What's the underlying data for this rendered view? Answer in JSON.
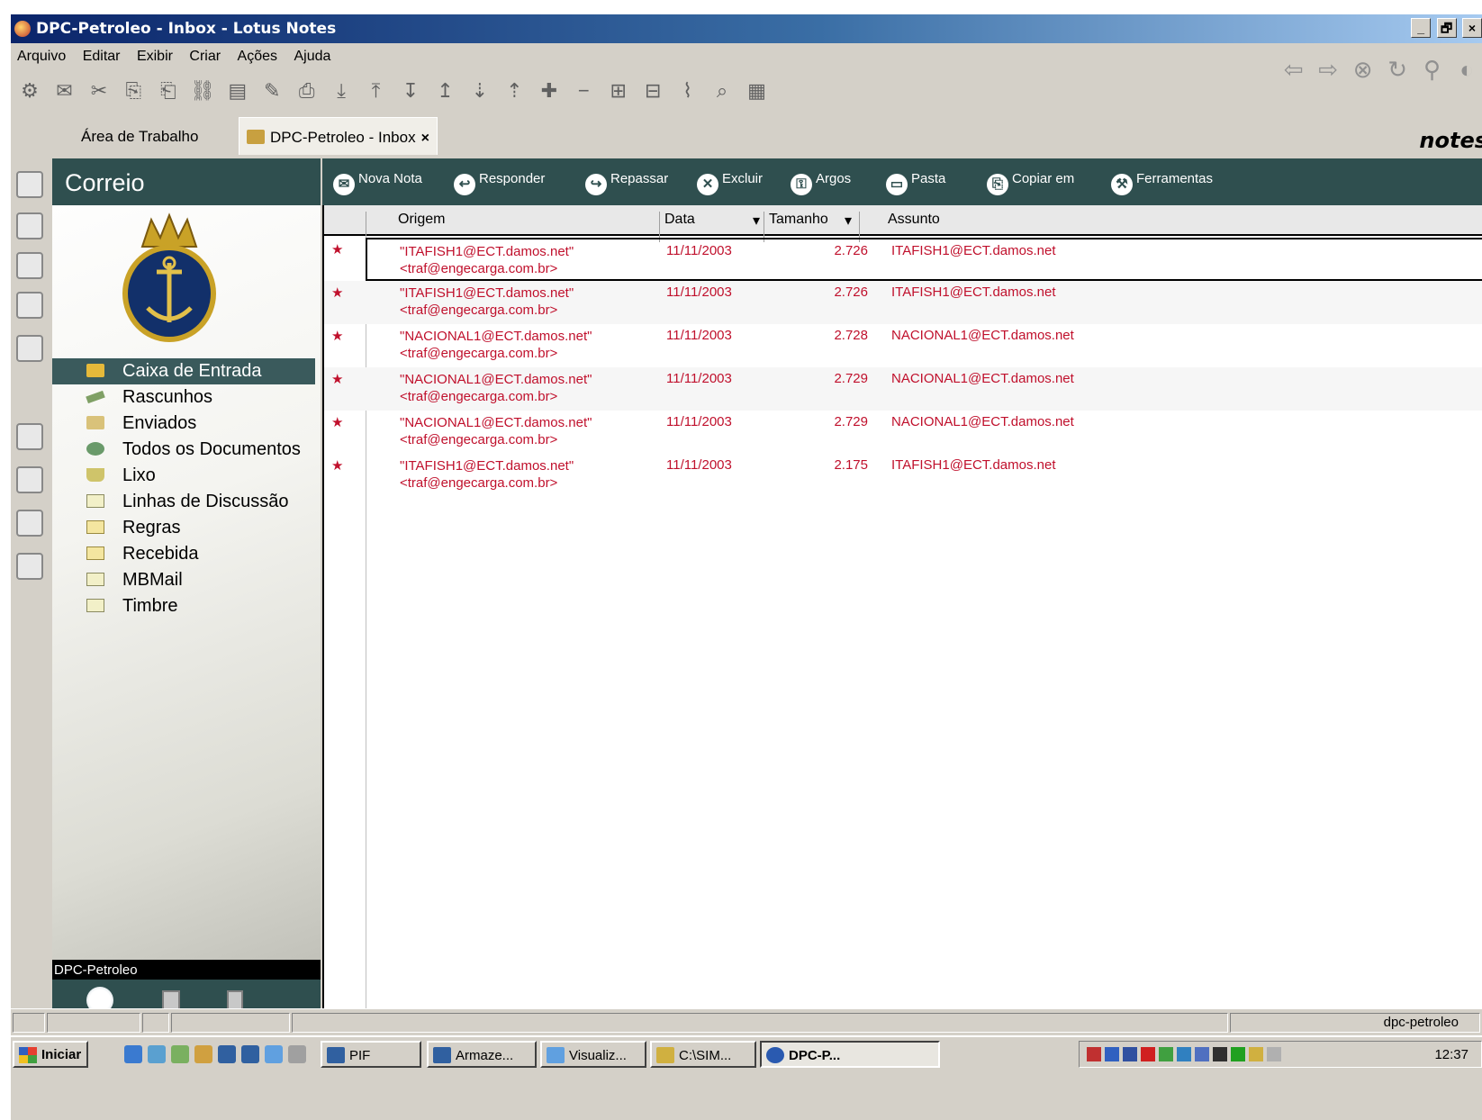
{
  "window": {
    "title": "DPC-Petroleo - Inbox - Lotus Notes",
    "controls": [
      "_",
      "🗗",
      "×"
    ]
  },
  "menu": [
    "Arquivo",
    "Editar",
    "Exibir",
    "Criar",
    "Ações",
    "Ajuda"
  ],
  "tabs": {
    "desktop": "Área de Trabalho",
    "inbox": "DPC-Petroleo - Inbox",
    "close": "×"
  },
  "brand": "notes",
  "navigator": {
    "title": "Correio",
    "folders": [
      {
        "label": "Caixa de Entrada",
        "icon": "inbox-icon"
      },
      {
        "label": "Rascunhos",
        "icon": "draft-icon"
      },
      {
        "label": "Enviados",
        "icon": "sent-icon"
      },
      {
        "label": "Todos os Documentos",
        "icon": "all-docs-icon"
      },
      {
        "label": "Lixo",
        "icon": "trash-icon"
      },
      {
        "label": "Linhas de Discussão",
        "icon": "view-icon"
      },
      {
        "label": "Regras",
        "icon": "folder-icon"
      },
      {
        "label": "Recebida",
        "icon": "folder-icon"
      },
      {
        "label": "MBMail",
        "icon": "view-icon"
      },
      {
        "label": "Timbre",
        "icon": "view-icon"
      }
    ],
    "footer": "DPC-Petroleo"
  },
  "actions": [
    {
      "label": "Nova Nota",
      "icon": "new-memo-icon"
    },
    {
      "label": "Responder",
      "icon": "reply-icon"
    },
    {
      "label": "Repassar",
      "icon": "forward-icon"
    },
    {
      "label": "Excluir",
      "icon": "delete-icon"
    },
    {
      "label": "Argos",
      "icon": "lock-icon"
    },
    {
      "label": "Pasta",
      "icon": "folder-icon"
    },
    {
      "label": "Copiar em",
      "icon": "copy-icon"
    },
    {
      "label": "Ferramentas",
      "icon": "tools-icon"
    }
  ],
  "columns": {
    "from": "Origem",
    "date": "Data",
    "size": "Tamanho",
    "subject": "Assunto"
  },
  "messages": [
    {
      "from": "\"ITAFISH1@ECT.damos.net\"",
      "email": "<traf@engecarga.com.br>",
      "date": "11/11/2003",
      "size": "2.726",
      "subject": "ITAFISH1@ECT.damos.net"
    },
    {
      "from": "\"ITAFISH1@ECT.damos.net\"",
      "email": "<traf@engecarga.com.br>",
      "date": "11/11/2003",
      "size": "2.726",
      "subject": "ITAFISH1@ECT.damos.net"
    },
    {
      "from": "\"NACIONAL1@ECT.damos.net\"",
      "email": "<traf@engecarga.com.br>",
      "date": "11/11/2003",
      "size": "2.728",
      "subject": "NACIONAL1@ECT.damos.net"
    },
    {
      "from": "\"NACIONAL1@ECT.damos.net\"",
      "email": "<traf@engecarga.com.br>",
      "date": "11/11/2003",
      "size": "2.729",
      "subject": "NACIONAL1@ECT.damos.net"
    },
    {
      "from": "\"NACIONAL1@ECT.damos.net\"",
      "email": "<traf@engecarga.com.br>",
      "date": "11/11/2003",
      "size": "2.729",
      "subject": "NACIONAL1@ECT.damos.net"
    },
    {
      "from": "\"ITAFISH1@ECT.damos.net\"",
      "email": "<traf@engecarga.com.br>",
      "date": "11/11/2003",
      "size": "2.175",
      "subject": "ITAFISH1@ECT.damos.net"
    }
  ],
  "status": {
    "user": "dpc-petroleo"
  },
  "taskbar": {
    "start": "Iniciar",
    "buttons": [
      "PIF",
      "Armaze...",
      "Visualiz...",
      "C:\\SIM...",
      "DPC-P..."
    ],
    "clock": "12:37"
  },
  "colors": {
    "accent": "#2f4f4f",
    "unread": "#c0102c",
    "selection": "#3a5a5c"
  }
}
